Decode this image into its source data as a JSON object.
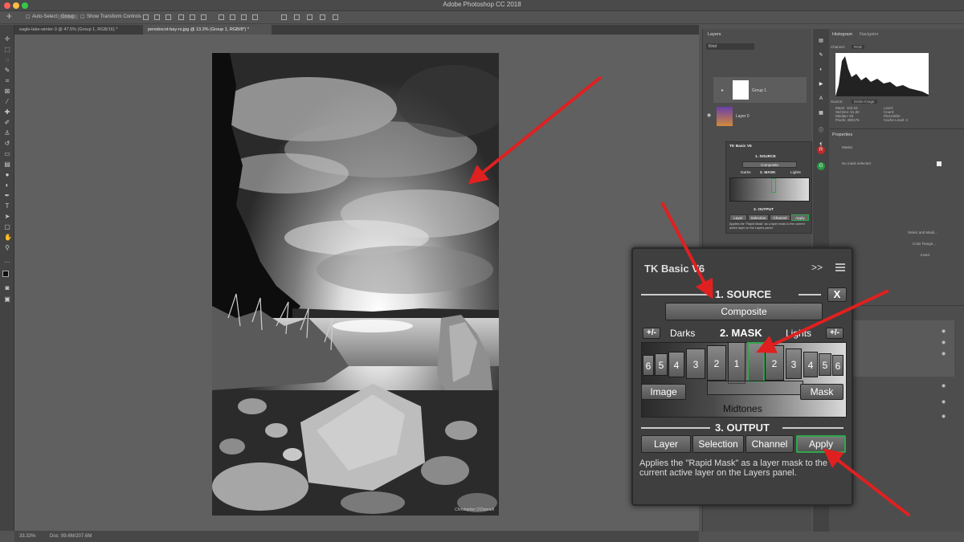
{
  "app": {
    "title": "Adobe Photoshop CC 2018"
  },
  "options_bar": {
    "auto_select_label": "Auto-Select:",
    "auto_select_value": "Group",
    "transform_label": "Show Transform Controls"
  },
  "tabs": [
    {
      "label": "eagle-lake-winter-3 @ 47.5% (Group 1, RGB/16) *"
    },
    {
      "label": "penobscot-bay-rs.jpg @ 13.3% (Group 1, RGB/8*) *"
    }
  ],
  "status": {
    "zoom": "33.33%",
    "doc": "Doc: 99.6M/207.6M"
  },
  "layers_panel": {
    "tab": "Layers",
    "kind_label": "Kind",
    "layers": [
      {
        "name": "Group 1"
      },
      {
        "name": "Layer 0"
      }
    ]
  },
  "histogram_panel": {
    "tabs": [
      "Histogram",
      "Navigator"
    ],
    "channel_label": "Channel:",
    "channel_value": "RGB",
    "source_label": "Source:",
    "source_value": "Entire Image",
    "stats_left": [
      "Mean: 102.53",
      "Std Dev: 61.82",
      "Median: 93",
      "Pixels: 490176"
    ],
    "stats_right": [
      "Level:",
      "Count:",
      "Percentile:",
      "Cache Level: 4"
    ]
  },
  "properties_panel": {
    "title": "Properties",
    "subtitle": "Masks",
    "mask_text": "No mask selected",
    "buttons": [
      "Select and Mask...",
      "Color Range...",
      "Invert"
    ]
  },
  "tk_small": {
    "title": "TK Basic V6",
    "source_header": "1. SOURCE",
    "composite": "Composite",
    "darks": "Darks",
    "mask_header": "2. MASK",
    "lights": "Lights",
    "output_header": "3. OUTPUT",
    "outputs": [
      "Layer",
      "Selection",
      "Channel",
      "Apply"
    ],
    "description": "Applies the \"Rapid Mask\" as a layer mask to the current active layer on the Layers panel."
  },
  "tk_large": {
    "title": "TK Basic V6",
    "collapse": ">>",
    "source_header": "1. SOURCE",
    "close": "X",
    "composite": "Composite",
    "plus_minus_left": "+/-",
    "darks": "Darks",
    "mask_header": "2. MASK",
    "lights": "Lights",
    "plus_minus_right": "+/-",
    "dark_steps": [
      "6",
      "5",
      "4",
      "3",
      "2",
      "1"
    ],
    "light_steps": [
      "2",
      "3",
      "4",
      "5",
      "6"
    ],
    "image_btn": "Image",
    "mask_btn": "Mask",
    "midtones": "Midtones",
    "output_header": "3. OUTPUT",
    "outputs": [
      "Layer",
      "Selection",
      "Channel",
      "Apply"
    ],
    "description": "Applies the \"Rapid Mask\" as a layer mask to the current active layer on the Layers panel."
  },
  "photo": {
    "signature": "Christopher O'Donnell"
  },
  "colors": {
    "accent_green": "#2ea84a",
    "arrow_red": "#e02020",
    "red_icon": "#c0282a",
    "green_icon": "#2a9a46"
  }
}
